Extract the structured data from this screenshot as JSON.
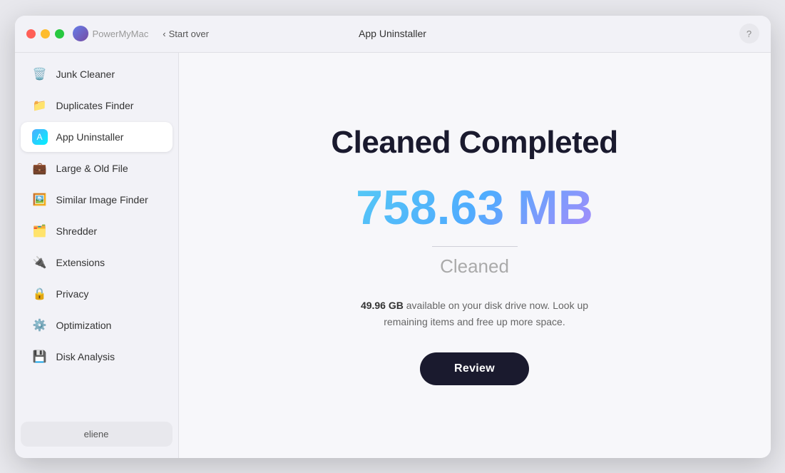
{
  "titlebar": {
    "app_name": "PowerMyMac",
    "start_over": "Start over",
    "page_title": "App Uninstaller",
    "help_label": "?"
  },
  "sidebar": {
    "items": [
      {
        "id": "junk-cleaner",
        "label": "Junk Cleaner",
        "icon": "🗑️",
        "active": false
      },
      {
        "id": "duplicates-finder",
        "label": "Duplicates Finder",
        "icon": "📁",
        "active": false
      },
      {
        "id": "app-uninstaller",
        "label": "App Uninstaller",
        "icon": "A",
        "active": true
      },
      {
        "id": "large-old-file",
        "label": "Large & Old File",
        "icon": "💼",
        "active": false
      },
      {
        "id": "similar-image-finder",
        "label": "Similar Image Finder",
        "icon": "🖼️",
        "active": false
      },
      {
        "id": "shredder",
        "label": "Shredder",
        "icon": "🗂️",
        "active": false
      },
      {
        "id": "extensions",
        "label": "Extensions",
        "icon": "🔌",
        "active": false
      },
      {
        "id": "privacy",
        "label": "Privacy",
        "icon": "🔒",
        "active": false
      },
      {
        "id": "optimization",
        "label": "Optimization",
        "icon": "⚙️",
        "active": false
      },
      {
        "id": "disk-analysis",
        "label": "Disk Analysis",
        "icon": "💾",
        "active": false
      }
    ],
    "user_label": "eliene"
  },
  "main": {
    "cleaned_title": "Cleaned Completed",
    "cleaned_amount": "758.63 MB",
    "cleaned_label": "Cleaned",
    "disk_available": "49.96 GB",
    "disk_message": " available on your disk drive now. Look up remaining items and free up more space.",
    "review_button": "Review"
  }
}
